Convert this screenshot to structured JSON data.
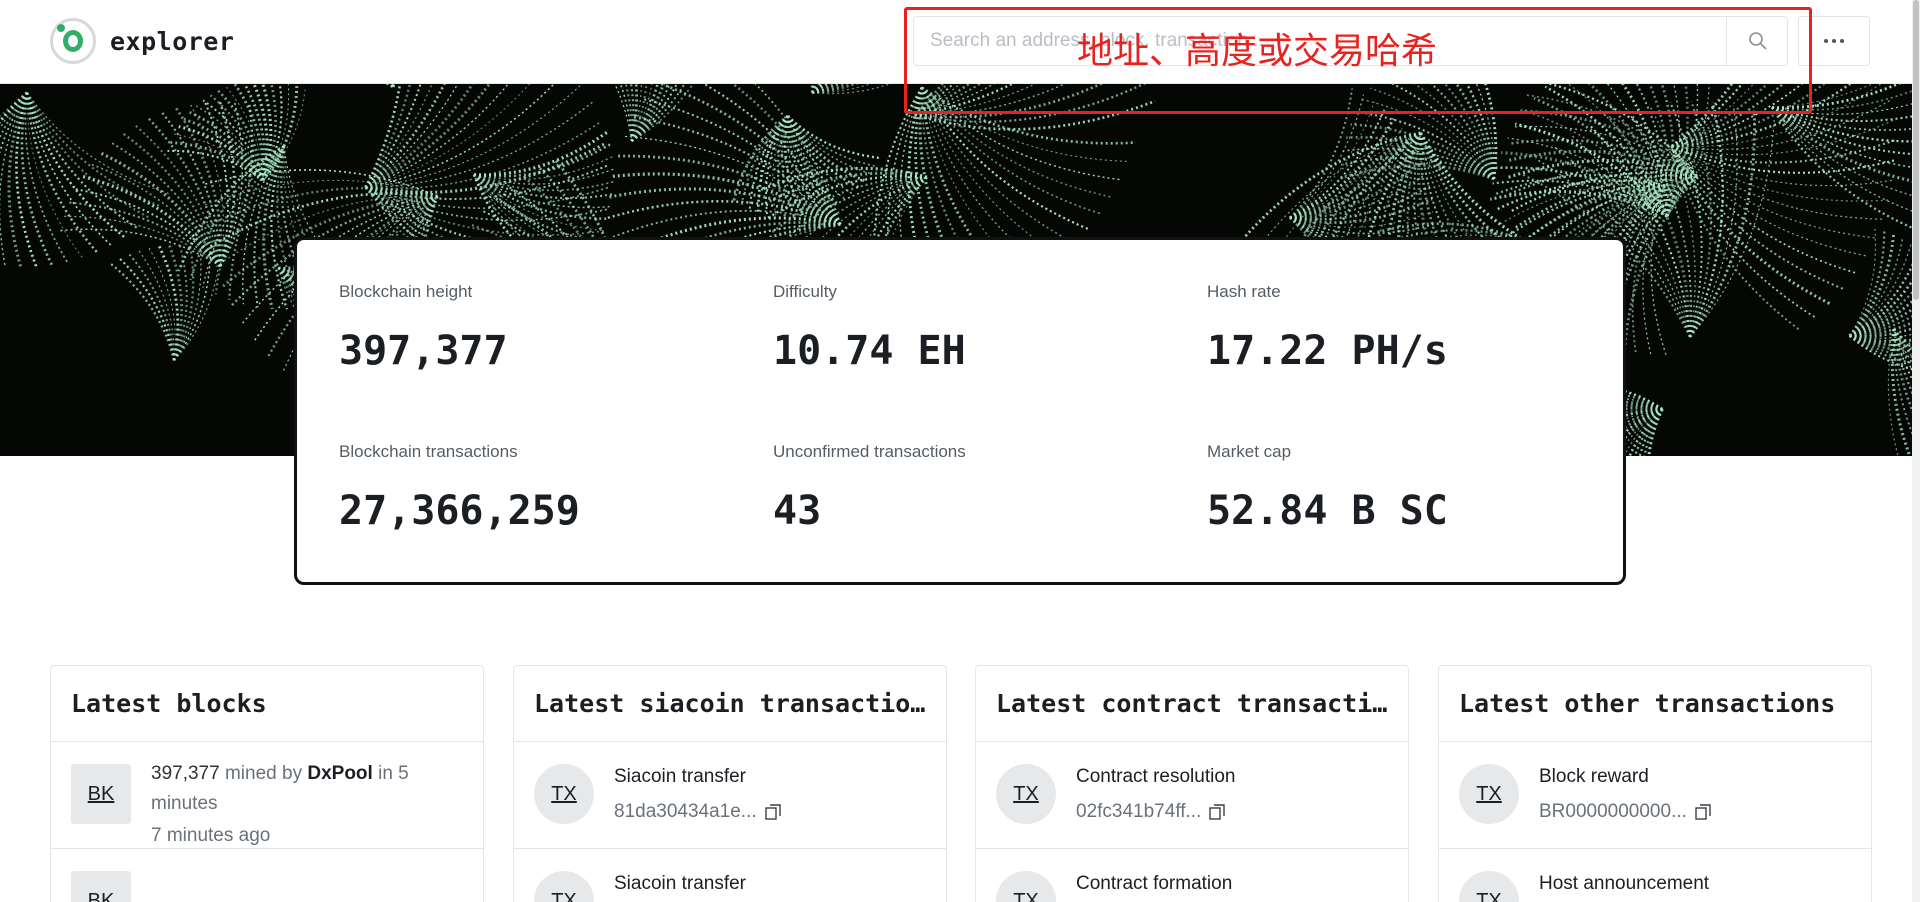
{
  "header": {
    "brand": "explorer",
    "search": {
      "placeholder": "Search an address, block, transaction..."
    },
    "annotation": "地址、高度或交易哈希"
  },
  "stats": [
    {
      "label": "Blockchain height",
      "value": "397,377"
    },
    {
      "label": "Difficulty",
      "value": "10.74 EH"
    },
    {
      "label": "Hash rate",
      "value": "17.22 PH/s"
    },
    {
      "label": "Blockchain transactions",
      "value": "27,366,259"
    },
    {
      "label": "Unconfirmed transactions",
      "value": "43"
    },
    {
      "label": "Market cap",
      "value": "52.84 B SC"
    }
  ],
  "panels": {
    "blocks": {
      "title": "Latest blocks",
      "badge": "BK",
      "rows": [
        {
          "height": "397,377",
          "mined_by": "mined by",
          "miner": "DxPool",
          "in_text": "in 5",
          "minutes": "minutes",
          "time": "7 minutes ago"
        }
      ]
    },
    "siacoin": {
      "title": "Latest siacoin transactions",
      "badge": "TX",
      "rows": [
        {
          "title": "Siacoin transfer",
          "hash": "81da30434a1e..."
        },
        {
          "title": "Siacoin transfer",
          "hash": ""
        }
      ]
    },
    "contract": {
      "title": "Latest contract transactions",
      "badge": "TX",
      "rows": [
        {
          "title": "Contract resolution",
          "hash": "02fc341b74ff..."
        },
        {
          "title": "Contract formation",
          "hash": ""
        }
      ]
    },
    "other": {
      "title": "Latest other transactions",
      "badge": "TX",
      "rows": [
        {
          "title": "Block reward",
          "hash": "BR0000000000..."
        },
        {
          "title": "Host announcement",
          "hash": ""
        }
      ]
    }
  },
  "colors": {
    "accent": "#2fae6b",
    "hero_pattern": "#a8e6c4",
    "annotation": "#e8231f"
  }
}
